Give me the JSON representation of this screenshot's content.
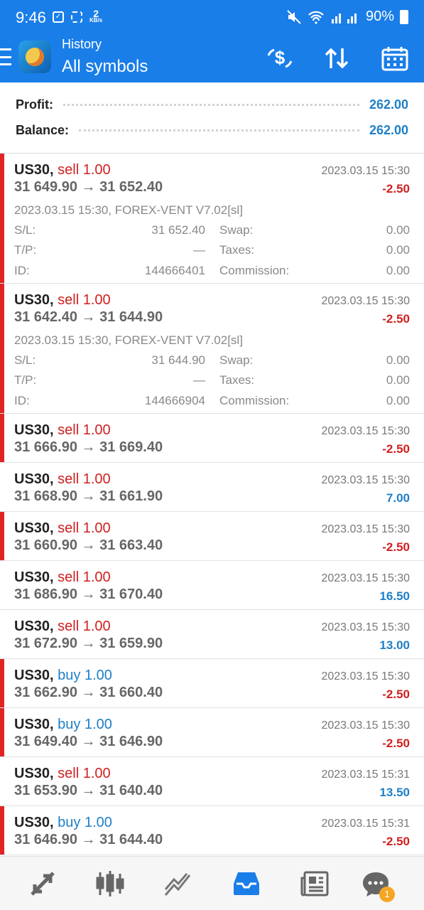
{
  "status_bar": {
    "time": "9:46",
    "kbs_top": "2",
    "kbs_bottom": "KB/s",
    "battery": "90%"
  },
  "app_bar": {
    "section": "History",
    "filter": "All symbols"
  },
  "summary": {
    "profit_label": "Profit:",
    "profit_value": "262.00",
    "balance_label": "Balance:",
    "balance_value": "262.00"
  },
  "trades": [
    {
      "symbol": "US30,",
      "side": "sell",
      "volume": "1.00",
      "prices": "31 649.90 → 31 652.40",
      "time": "2023.03.15 15:30",
      "pl": "-2.50",
      "comment": "2023.03.15 15:30, FOREX-VENT V7.02[sl]",
      "sl_label": "S/L:",
      "sl": "31 652.40",
      "tp_label": "T/P:",
      "tp": "—",
      "id_label": "ID:",
      "id": "144666401",
      "swap_label": "Swap:",
      "swap": "0.00",
      "taxes_label": "Taxes:",
      "taxes": "0.00",
      "commission_label": "Commission:",
      "commission": "0.00"
    },
    {
      "symbol": "US30,",
      "side": "sell",
      "volume": "1.00",
      "prices": "31 642.40 → 31 644.90",
      "time": "2023.03.15 15:30",
      "pl": "-2.50",
      "comment": "2023.03.15 15:30, FOREX-VENT V7.02[sl]",
      "sl_label": "S/L:",
      "sl": "31 644.90",
      "tp_label": "T/P:",
      "tp": "—",
      "id_label": "ID:",
      "id": "144666904",
      "swap_label": "Swap:",
      "swap": "0.00",
      "taxes_label": "Taxes:",
      "taxes": "0.00",
      "commission_label": "Commission:",
      "commission": "0.00"
    },
    {
      "symbol": "US30,",
      "side": "sell",
      "volume": "1.00",
      "prices": "31 666.90 → 31 669.40",
      "time": "2023.03.15 15:30",
      "pl": "-2.50"
    },
    {
      "symbol": "US30,",
      "side": "sell",
      "volume": "1.00",
      "prices": "31 668.90 → 31 661.90",
      "time": "2023.03.15 15:30",
      "pl": "7.00"
    },
    {
      "symbol": "US30,",
      "side": "sell",
      "volume": "1.00",
      "prices": "31 660.90 → 31 663.40",
      "time": "2023.03.15 15:30",
      "pl": "-2.50"
    },
    {
      "symbol": "US30,",
      "side": "sell",
      "volume": "1.00",
      "prices": "31 686.90 → 31 670.40",
      "time": "2023.03.15 15:30",
      "pl": "16.50"
    },
    {
      "symbol": "US30,",
      "side": "sell",
      "volume": "1.00",
      "prices": "31 672.90 → 31 659.90",
      "time": "2023.03.15 15:30",
      "pl": "13.00"
    },
    {
      "symbol": "US30,",
      "side": "buy",
      "volume": "1.00",
      "prices": "31 662.90 → 31 660.40",
      "time": "2023.03.15 15:30",
      "pl": "-2.50"
    },
    {
      "symbol": "US30,",
      "side": "buy",
      "volume": "1.00",
      "prices": "31 649.40 → 31 646.90",
      "time": "2023.03.15 15:30",
      "pl": "-2.50"
    },
    {
      "symbol": "US30,",
      "side": "sell",
      "volume": "1.00",
      "prices": "31 653.90 → 31 640.40",
      "time": "2023.03.15 15:31",
      "pl": "13.50"
    },
    {
      "symbol": "US30,",
      "side": "buy",
      "volume": "1.00",
      "prices": "31 646.90 → 31 644.40",
      "time": "2023.03.15 15:31",
      "pl": "-2.50"
    }
  ],
  "bottom_nav": {
    "items": [
      {
        "icon": "quotes-icon"
      },
      {
        "icon": "chart-icon"
      },
      {
        "icon": "trade-icon"
      },
      {
        "icon": "history-icon"
      },
      {
        "icon": "news-icon"
      },
      {
        "icon": "messages-icon"
      }
    ],
    "messages_badge": "1"
  },
  "colors": {
    "accent": "#1a7ee8",
    "loss": "#d11f1f",
    "profit": "#1f7fc6",
    "loss_bar": "#e02424"
  }
}
